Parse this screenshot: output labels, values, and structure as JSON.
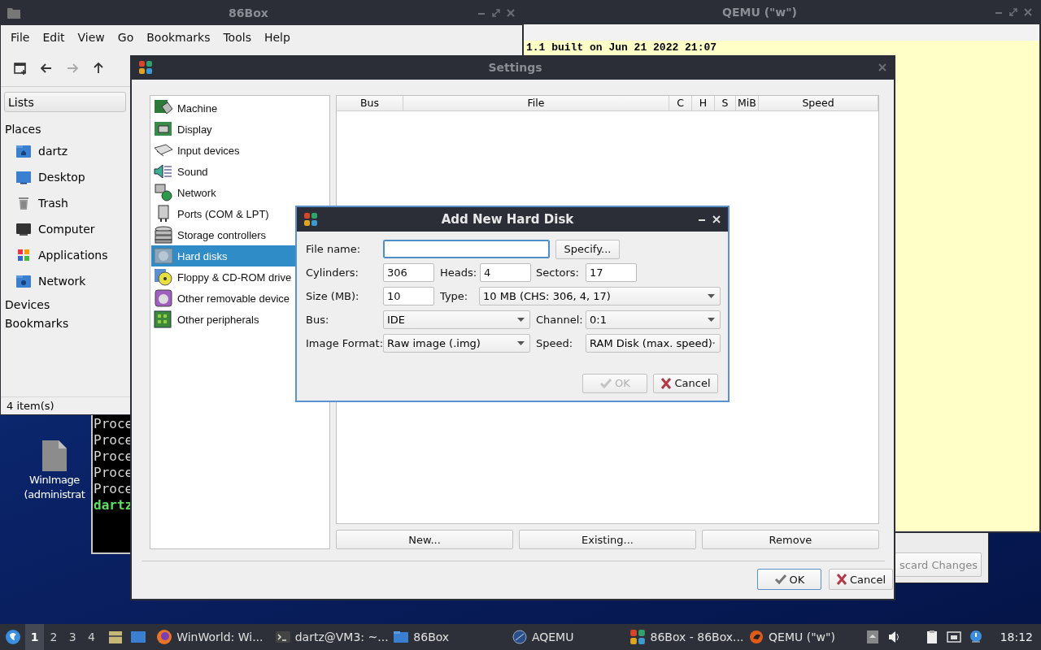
{
  "file_manager": {
    "title": "86Box",
    "menu": [
      "File",
      "Edit",
      "View",
      "Go",
      "Bookmarks",
      "Tools",
      "Help"
    ],
    "toolbar": [
      {
        "kind": "new-tab",
        "disabled": false
      },
      {
        "kind": "back",
        "disabled": false
      },
      {
        "kind": "forward",
        "disabled": true
      },
      {
        "kind": "up",
        "disabled": false
      }
    ],
    "pane_selector": "Lists",
    "places_heading": "Places",
    "places": [
      {
        "label": "dartz",
        "kind": "home"
      },
      {
        "label": "Desktop",
        "kind": "desktop"
      },
      {
        "label": "Trash",
        "kind": "trash"
      },
      {
        "label": "Computer",
        "kind": "computer"
      },
      {
        "label": "Applications",
        "kind": "apps"
      },
      {
        "label": "Network",
        "kind": "network"
      }
    ],
    "more_headings": [
      "Devices",
      "Bookmarks"
    ],
    "status": "4 item(s)"
  },
  "qemu": {
    "title": "QEMU (\"w\")",
    "console_line": "1.1 built on Jun 21 2022 21:07"
  },
  "background_window": {
    "button": "scard Changes"
  },
  "terminal": {
    "lines": [
      "Proce",
      "Proce",
      "Proce",
      "Proce",
      "Proce"
    ],
    "prompt": "dartz"
  },
  "desktop_icon": {
    "label_lines": [
      "WinImage",
      "(administrat"
    ]
  },
  "settings": {
    "title": "Settings",
    "categories": [
      {
        "label": "Machine",
        "kind": "machine",
        "selected": false
      },
      {
        "label": "Display",
        "kind": "display",
        "selected": false
      },
      {
        "label": "Input devices",
        "kind": "input",
        "selected": false
      },
      {
        "label": "Sound",
        "kind": "sound",
        "selected": false
      },
      {
        "label": "Network",
        "kind": "network",
        "selected": false
      },
      {
        "label": "Ports (COM & LPT)",
        "kind": "ports",
        "selected": false
      },
      {
        "label": "Storage controllers",
        "kind": "storage",
        "selected": false
      },
      {
        "label": "Hard disks",
        "kind": "hdd",
        "selected": true
      },
      {
        "label": "Floppy & CD-ROM drive",
        "kind": "floppy",
        "selected": false
      },
      {
        "label": "Other removable device",
        "kind": "removable",
        "selected": false
      },
      {
        "label": "Other peripherals",
        "kind": "peripherals",
        "selected": false
      }
    ],
    "table_columns": [
      "Bus",
      "File",
      "C",
      "H",
      "S",
      "MiB",
      "Speed"
    ],
    "disk_buttons": [
      "New...",
      "Existing...",
      "Remove"
    ],
    "buttons": [
      {
        "label": "OK",
        "kind": "ok"
      },
      {
        "label": "Cancel",
        "kind": "cancel"
      }
    ]
  },
  "dialog": {
    "title": "Add New Hard Disk",
    "file_name": {
      "label": "File name:",
      "focused": true
    },
    "specify": "Specify...",
    "cylinders": {
      "label": "Cylinders:",
      "value": "306"
    },
    "heads": {
      "label": "Heads:",
      "value": "4"
    },
    "sectors": {
      "label": "Sectors:",
      "value": "17"
    },
    "size": {
      "label": "Size (MB):",
      "value": "10"
    },
    "type": {
      "label": "Type:",
      "value": "10 MB (CHS: 306, 4, 17)"
    },
    "bus": {
      "label": "Bus:",
      "value": "IDE"
    },
    "channel": {
      "label": "Channel:",
      "value": "0:1"
    },
    "image_format": {
      "label": "Image Format:",
      "value": "Raw image (.img)"
    },
    "speed": {
      "label": "Speed:",
      "value": "RAM Disk (max. speed)"
    },
    "buttons": [
      {
        "label": "OK",
        "kind": "ok",
        "disabled": true
      },
      {
        "label": "Cancel",
        "kind": "cancel",
        "disabled": false
      }
    ]
  },
  "taskbar": {
    "workspaces": [
      {
        "label": "1",
        "selected": true
      },
      {
        "label": "2",
        "selected": false
      },
      {
        "label": "3",
        "selected": false
      },
      {
        "label": "4",
        "selected": false
      }
    ],
    "tasks": [
      {
        "label": "WinWorld: Wi...",
        "kind": "browser"
      },
      {
        "label": "dartz@VM3: ~...",
        "kind": "terminal"
      },
      {
        "label": "86Box",
        "kind": "folder"
      },
      {
        "label": "AQEMU",
        "kind": "aqemu"
      },
      {
        "label": "86Box - 86Box...",
        "kind": "emulator"
      },
      {
        "label": "QEMU (\"w\")",
        "kind": "qemu"
      }
    ],
    "clock": "18:12"
  }
}
